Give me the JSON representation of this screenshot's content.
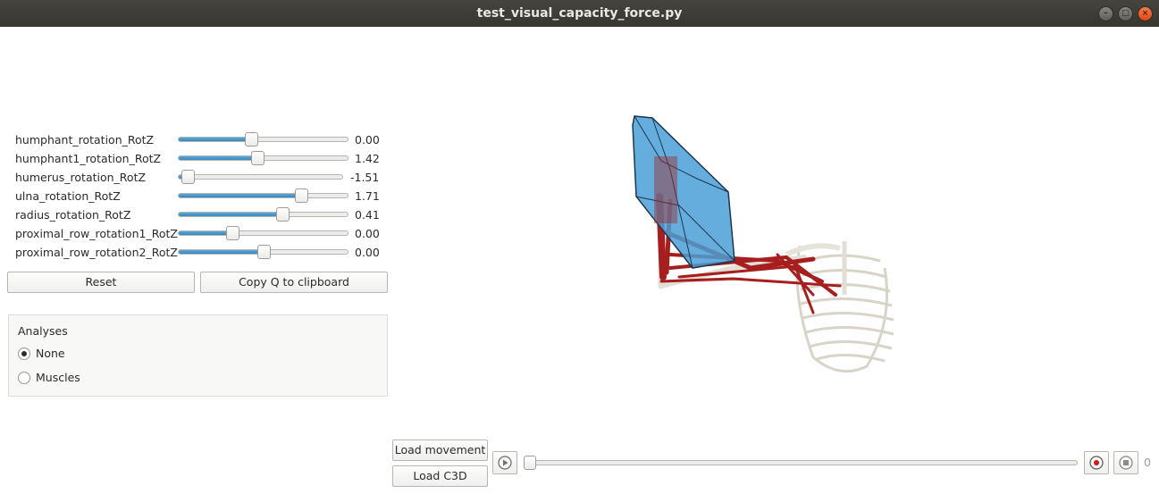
{
  "window": {
    "title": "test_visual_capacity_force.py",
    "minimize_glyph": "–",
    "maximize_glyph": "□",
    "close_glyph": "×"
  },
  "sliders": [
    {
      "label": "humphant_rotation_RotZ",
      "value": "0.00",
      "fraction": 0.42
    },
    {
      "label": "humphant1_rotation_RotZ",
      "value": "1.42",
      "fraction": 0.46
    },
    {
      "label": "humerus_rotation_RotZ",
      "value": "-1.51",
      "fraction": 0.02
    },
    {
      "label": "ulna_rotation_RotZ",
      "value": "1.71",
      "fraction": 0.74
    },
    {
      "label": "radius_rotation_RotZ",
      "value": "0.41",
      "fraction": 0.62
    },
    {
      "label": "proximal_row_rotation1_RotZ",
      "value": "0.00",
      "fraction": 0.3
    },
    {
      "label": "proximal_row_rotation2_RotZ",
      "value": "0.00",
      "fraction": 0.5
    }
  ],
  "buttons": {
    "reset": "Reset",
    "copy_q": "Copy Q to clipboard",
    "load_movement": "Load movement",
    "load_c3d": "Load C3D"
  },
  "analyses": {
    "title": "Analyses",
    "options": [
      {
        "label": "None",
        "checked": true
      },
      {
        "label": "Muscles",
        "checked": false
      }
    ]
  },
  "player": {
    "frame": "0",
    "play_icon": "play-icon",
    "record_icon": "record-icon",
    "stop_icon": "stop-icon"
  },
  "colors": {
    "accent": "#3a87c0",
    "muscle": "#a61e1e",
    "bone": "#e4e1d8",
    "capacity_volume": "#4a9fd6"
  }
}
